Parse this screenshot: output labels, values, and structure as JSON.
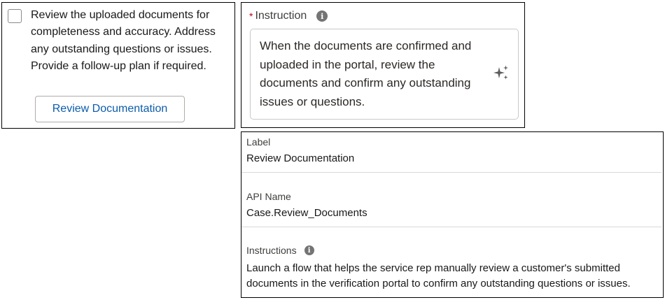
{
  "task_card": {
    "checked": false,
    "text": "Review the uploaded documents for completeness and accuracy. Address any outstanding questions or issues. Provide a follow-up plan if required.",
    "button_label": "Review Documentation"
  },
  "instruction_field": {
    "required_marker": "*",
    "label": "Instruction",
    "info_icon": "i",
    "value": "When the documents are confirmed and uploaded in the portal, review the documents and confirm any outstanding issues or questions.",
    "ai_icon": "sparkle-icon"
  },
  "details": {
    "label_title": "Label",
    "label_value": "Review Documentation",
    "api_name_title": "API Name",
    "api_name_value": "Case.Review_Documents",
    "instructions_title": "Instructions",
    "info_icon": "i",
    "instructions_value": "Launch a flow that helps the service rep manually review a customer's submitted documents in the verification portal to confirm any outstanding questions or issues."
  },
  "colors": {
    "link_blue": "#0b5cab",
    "required_red": "#ba0517",
    "info_gray": "#747474"
  }
}
